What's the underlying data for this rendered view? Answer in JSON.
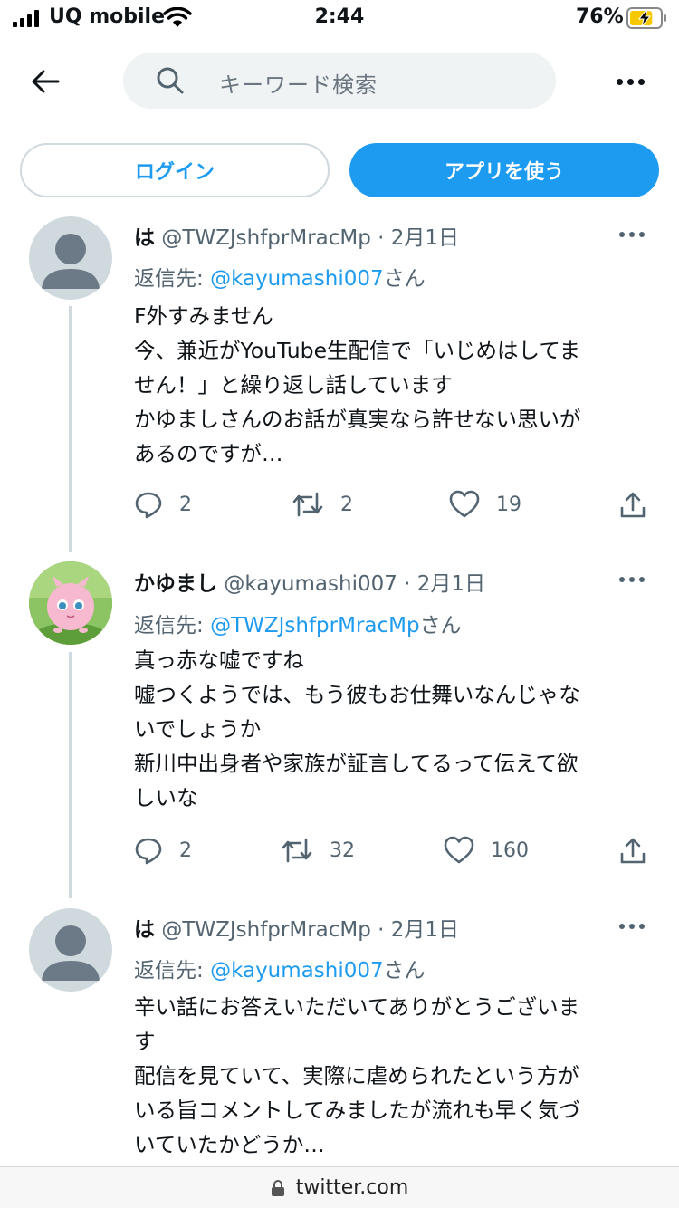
{
  "status_bar": {
    "carrier": "UQ mobile",
    "time": "2:44",
    "battery_percent": "76%",
    "battery_level": 0.76
  },
  "header": {
    "search_placeholder": "キーワード検索"
  },
  "buttons": {
    "login_label": "ログイン",
    "app_label": "アプリを使う"
  },
  "tweets": [
    {
      "name": "は",
      "handle": "@TWZJshfprMracMp",
      "date": "2月1日",
      "reply_prefix": "返信先: ",
      "reply_handle": "@kayumashi007",
      "reply_suffix": "さん",
      "lines": [
        "F外すみません",
        "今、兼近がYouTube生配信で「いじめはしてま",
        "せん！」と繰り返し話しています",
        "かゆましさんのお話が真実なら許せない思いが",
        "あるのですが…"
      ],
      "replies": "2",
      "retweets": "2",
      "likes": "19"
    },
    {
      "name": "かゆまし",
      "handle": "@kayumashi007",
      "date": "2月1日",
      "reply_prefix": "返信先: ",
      "reply_handle": "@TWZJshfprMracMp",
      "reply_suffix": "さん",
      "lines": [
        "真っ赤な嘘ですね",
        "嘘つくようでは、もう彼もお仕舞いなんじゃな",
        "いでしょうか",
        "新川中出身者や家族が証言してるって伝えて欲",
        "しいな"
      ],
      "replies": "2",
      "retweets": "32",
      "likes": "160"
    },
    {
      "name": "は",
      "handle": "@TWZJshfprMracMp",
      "date": "2月1日",
      "reply_prefix": "返信先: ",
      "reply_handle": "@kayumashi007",
      "reply_suffix": "さん",
      "lines": [
        "辛い話にお答えいただいてありがとうございま",
        "す",
        "配信を見ていて、実際に虐められたという方が",
        "いる旨コメントしてみましたが流れも早く気づ",
        "いていたかどうか…"
      ]
    }
  ],
  "url_bar": {
    "domain": "twitter.com"
  },
  "colors": {
    "accent": "#1d9bf0",
    "text": "#0f1419",
    "secondary_text": "#536471",
    "thread_line": "#cfd9de",
    "battery_fill": "#f5c800"
  }
}
